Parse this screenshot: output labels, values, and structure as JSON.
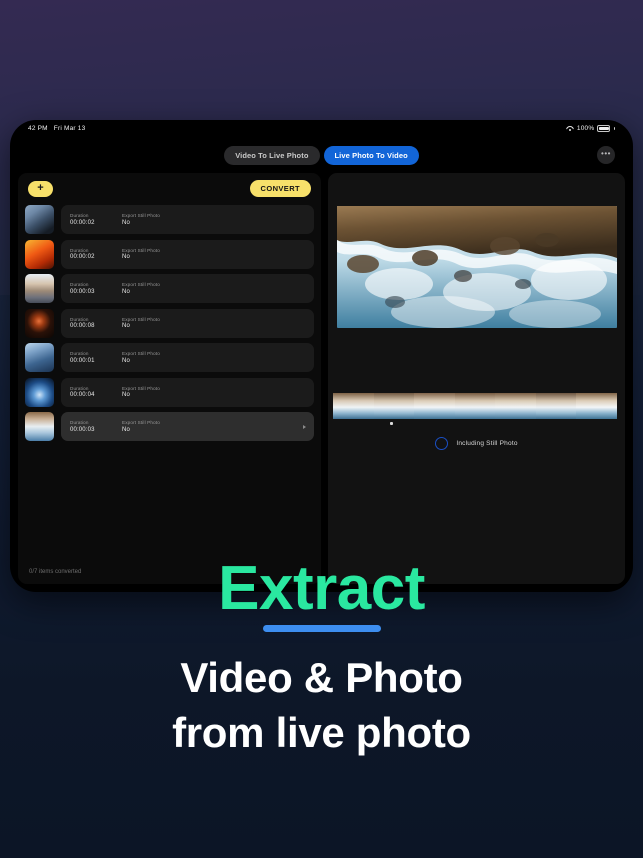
{
  "statusbar": {
    "time": "42 PM",
    "date": "Fri Mar 13",
    "wifi_icon": "wifi-icon",
    "battery_percent": "100%",
    "battery_icon": "battery-icon"
  },
  "navbar": {
    "segments": [
      {
        "label": "Video To Live Photo",
        "active": false
      },
      {
        "label": "Live Photo To Video",
        "active": true
      }
    ],
    "more_label": "•••",
    "more_icon": "ellipsis-icon"
  },
  "left_pane": {
    "add_label": "+",
    "convert_label": "CONVERT",
    "duration_label": "Duration",
    "export_label": "Export Still Photo",
    "rows": [
      {
        "duration": "00:00:02",
        "export_still": "No",
        "thumb": "ice-blue",
        "selected": false
      },
      {
        "duration": "00:00:02",
        "export_still": "No",
        "thumb": "fire-orange",
        "selected": false
      },
      {
        "duration": "00:00:03",
        "export_still": "No",
        "thumb": "desert",
        "selected": false
      },
      {
        "duration": "00:00:08",
        "export_still": "No",
        "thumb": "dark-ember",
        "selected": false
      },
      {
        "duration": "00:00:01",
        "export_still": "No",
        "thumb": "blue-mountain",
        "selected": false
      },
      {
        "duration": "00:00:04",
        "export_still": "No",
        "thumb": "jellyfish",
        "selected": false
      },
      {
        "duration": "00:00:03",
        "export_still": "No",
        "thumb": "surf-rocks",
        "selected": true
      }
    ],
    "status_text": "0/7 items converted"
  },
  "right_pane": {
    "preview_alt": "aerial photo of ocean waves crashing on rocky coast",
    "still_photo_label": "Including Still Photo",
    "still_photo_checked": false
  },
  "marketing": {
    "headline": "Extract",
    "subhead_line1": "Video & Photo",
    "subhead_line2": "from live photo",
    "headline_color": "#2ae8a0",
    "underline_color": "#3d8ef0",
    "subhead_color": "#ffffff"
  }
}
